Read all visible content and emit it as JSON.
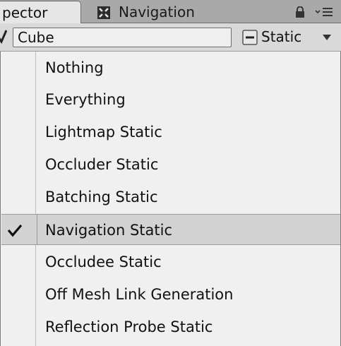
{
  "tabs": [
    {
      "label": "pector",
      "active": true
    },
    {
      "label": "Navigation",
      "active": false
    }
  ],
  "header": {
    "name_value": "Cube",
    "static_label": "Static"
  },
  "menu": {
    "items": [
      {
        "label": "Nothing",
        "checked": false
      },
      {
        "label": "Everything",
        "checked": false
      },
      {
        "label": "Lightmap Static",
        "checked": false
      },
      {
        "label": "Occluder Static",
        "checked": false
      },
      {
        "label": "Batching Static",
        "checked": false
      },
      {
        "label": "Navigation Static",
        "checked": true
      },
      {
        "label": "Occludee Static",
        "checked": false
      },
      {
        "label": "Off Mesh Link Generation",
        "checked": false
      },
      {
        "label": "Reflection Probe Static",
        "checked": false
      }
    ]
  },
  "icons": {
    "navigation_tab": "navigation-icon",
    "lock": "lock-icon",
    "options": "menu-icon",
    "active_toggle": "active-checkbox-icon",
    "static_toggle": "static-mixed-checkbox-icon",
    "dropdown": "chevron-down-icon",
    "selected_mark": "checkmark-icon"
  },
  "colors": {
    "tabbar": "#a9a9a9",
    "active_tab": "#e6e6e6",
    "menu_background": "#f0f0f0",
    "selected_row": "#d3d3d3"
  }
}
